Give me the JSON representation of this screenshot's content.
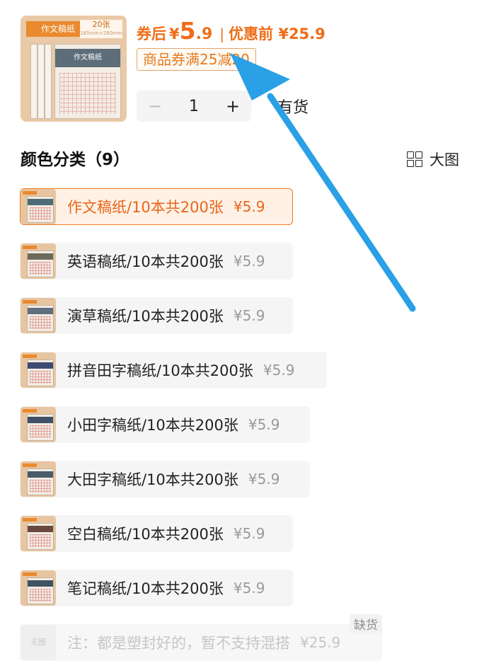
{
  "product": {
    "thumb_label": "作文稿纸",
    "thumb_count": "20张",
    "thumb_size": "185mm×260mm",
    "thumb_book_title": "作文稿纸",
    "price_after_label": "券后",
    "currency": "¥",
    "price_int": "5",
    "price_dec": ".9",
    "price_sep": "|",
    "price_before_label": "优惠前 ¥25.9",
    "coupon": "商品券满25减20",
    "stepper": {
      "minus": "−",
      "value": "1",
      "plus": "+"
    },
    "stock_text": "有货"
  },
  "section": {
    "title": "颜色分类（9）",
    "big_view": "大图"
  },
  "options": [
    {
      "name": "作文稿纸/10本共200张",
      "price": "¥5.9",
      "state": "selected",
      "head_color": "#4f6b78"
    },
    {
      "name": "英语稿纸/10本共200张",
      "price": "¥5.9",
      "state": "normal",
      "head_color": "#6c6a5a"
    },
    {
      "name": "演草稿纸/10本共200张",
      "price": "¥5.9",
      "state": "normal",
      "head_color": "#5f6f7c"
    },
    {
      "name": "拼音田字稿纸/10本共200张",
      "price": "¥5.9",
      "state": "normal",
      "head_color": "#3e4b73"
    },
    {
      "name": "小田字稿纸/10本共200张",
      "price": "¥5.9",
      "state": "normal",
      "head_color": "#3f5068"
    },
    {
      "name": "大田字稿纸/10本共200张",
      "price": "¥5.9",
      "state": "normal",
      "head_color": "#4a5a68"
    },
    {
      "name": "空白稿纸/10本共200张",
      "price": "¥5.9",
      "state": "normal",
      "head_color": "#6a4a3e"
    },
    {
      "name": "笔记稿纸/10本共200张",
      "price": "¥5.9",
      "state": "normal",
      "head_color": "#3e5360"
    },
    {
      "name": "注：都是塑封好的，暂不支持混搭",
      "price": "¥25.9",
      "state": "disabled",
      "badge": "缺货",
      "thumb_text": "无图"
    }
  ],
  "colors": {
    "accent": "#ef6d18",
    "annotation_arrow": "#2aa0e6"
  }
}
